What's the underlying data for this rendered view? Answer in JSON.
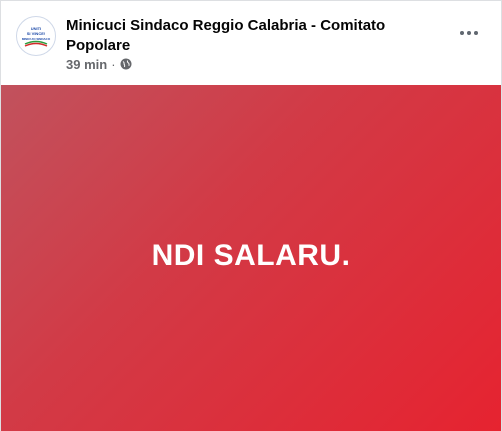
{
  "post": {
    "page_name": "Minicuci Sindaco Reggio Calabria - Comitato Popolare",
    "timestamp": "39 min",
    "separator": "·",
    "audience_icon": "globe-icon",
    "more_icon": "more-options-icon",
    "avatar_text_line1": "UNITI",
    "avatar_text_line2": "SI VINCE!",
    "avatar_text_line3": "MINICUCI SINDACO",
    "body_text": "NDI SALARU.",
    "colors": {
      "gradient_start": "#c1525d",
      "gradient_end": "#e62330",
      "text": "#ffffff",
      "meta": "#65676b"
    }
  }
}
